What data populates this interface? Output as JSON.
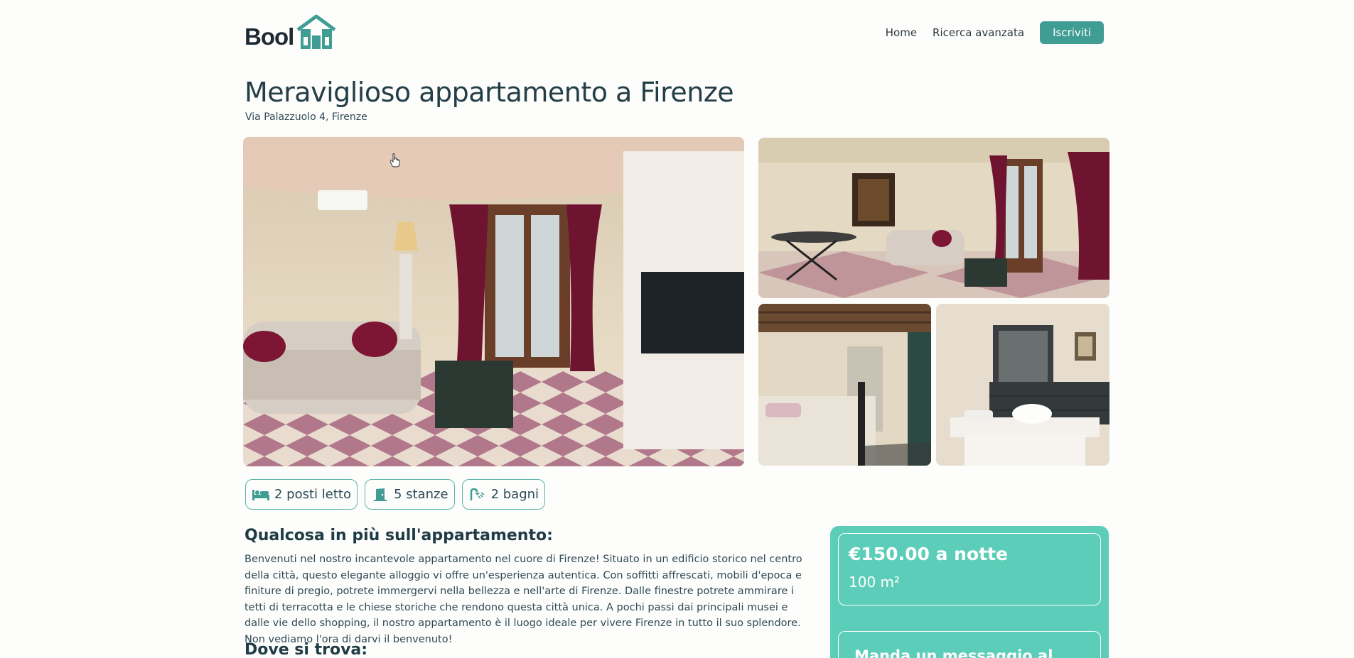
{
  "header": {
    "logo_text": "Bool",
    "logo_icon": "house-bnb-icon",
    "nav": {
      "home": "Home",
      "advanced_search": "Ricerca avanzata",
      "signup": "Iscriviti"
    }
  },
  "listing": {
    "title": "Meraviglioso appartamento a Firenze",
    "address": "Via Palazzuolo 4, Firenze"
  },
  "features": [
    {
      "icon": "bed-icon",
      "label": "2 posti letto"
    },
    {
      "icon": "door-icon",
      "label": "5 stanze"
    },
    {
      "icon": "shower-icon",
      "label": "2 bagni"
    }
  ],
  "description": {
    "title": "Qualcosa in più sull'appartamento:",
    "text": "Benvenuti nel nostro incantevole appartamento nel cuore di Firenze! Situato in un edificio storico nel centro della città, questo elegante alloggio vi offre un'esperienza autentica. Con soffitti affrescati, mobili d'epoca e finiture di pregio, potrete immergervi nella bellezza e nell'arte di Firenze. Dalle finestre potrete ammirare i tetti di terracotta e le chiese storiche che rendono questa città unica. A pochi passi dai principali musei e dalle vie dello shopping, il nostro appartamento è il luogo ideale per vivere Firenze in tutto il suo splendore. Non vediamo l'ora di darvi il benvenuto!"
  },
  "location": {
    "title": "Dove si trova:"
  },
  "price_card": {
    "price": "€150.00 a notte",
    "area": "100 m²",
    "message_title": "Manda un messaggio al"
  },
  "colors": {
    "accent": "#3f9d94",
    "card": "#5ccdb8",
    "text": "#1f3b45"
  }
}
